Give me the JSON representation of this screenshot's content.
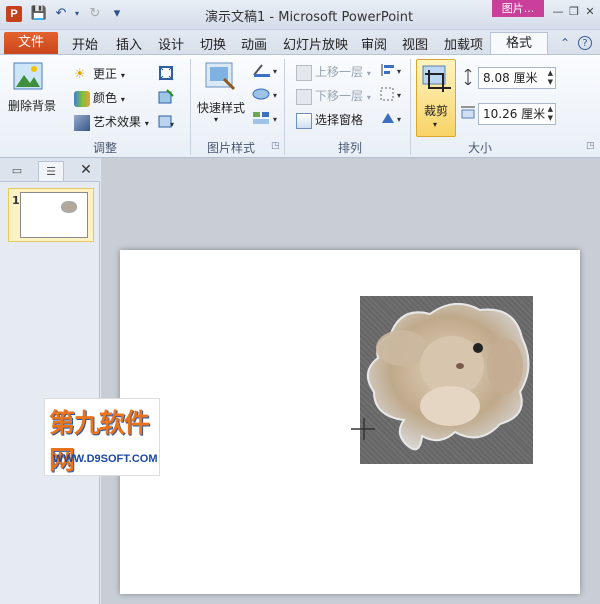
{
  "window": {
    "title": "演示文稿1 - Microsoft PowerPoint",
    "context_tab_title": "图片...",
    "controls": {
      "minimize": "—",
      "restore": "❐",
      "close": "✕"
    }
  },
  "quick_access": {
    "app_icon": "P",
    "save": "💾",
    "undo": "↶",
    "redo": "↻",
    "customize": "▾"
  },
  "tabs": {
    "file": "文件",
    "items": [
      "开始",
      "插入",
      "设计",
      "切换",
      "动画",
      "幻灯片放映",
      "审阅",
      "视图",
      "加载项"
    ],
    "active": "格式",
    "help_icons": {
      "minimize_ribbon": "⌃",
      "help": "?"
    }
  },
  "ribbon": {
    "adjust": {
      "label": "调整",
      "remove_bg": "删除背景",
      "corrections": "更正",
      "color": "颜色",
      "artistic": "艺术效果"
    },
    "picture_styles": {
      "label": "图片样式",
      "quick_styles": "快速样式"
    },
    "arrange": {
      "label": "排列",
      "bring_forward": "上移一层",
      "send_backward": "下移一层",
      "selection_pane": "选择窗格"
    },
    "size": {
      "label": "大小",
      "crop": "裁剪",
      "height": "8.08 厘米",
      "width": "10.26 厘米"
    }
  },
  "left_panel": {
    "tab_slides": "▭",
    "tab_outline": "☰",
    "close": "✕",
    "slide_number": "1"
  },
  "watermark": {
    "title": "第九软件网",
    "url": "WWW.D9SOFT.COM"
  },
  "colors": {
    "file_tab": "#d24b1f",
    "context_tab": "#c93f9a",
    "ribbon_bg": "#eef3f9"
  }
}
